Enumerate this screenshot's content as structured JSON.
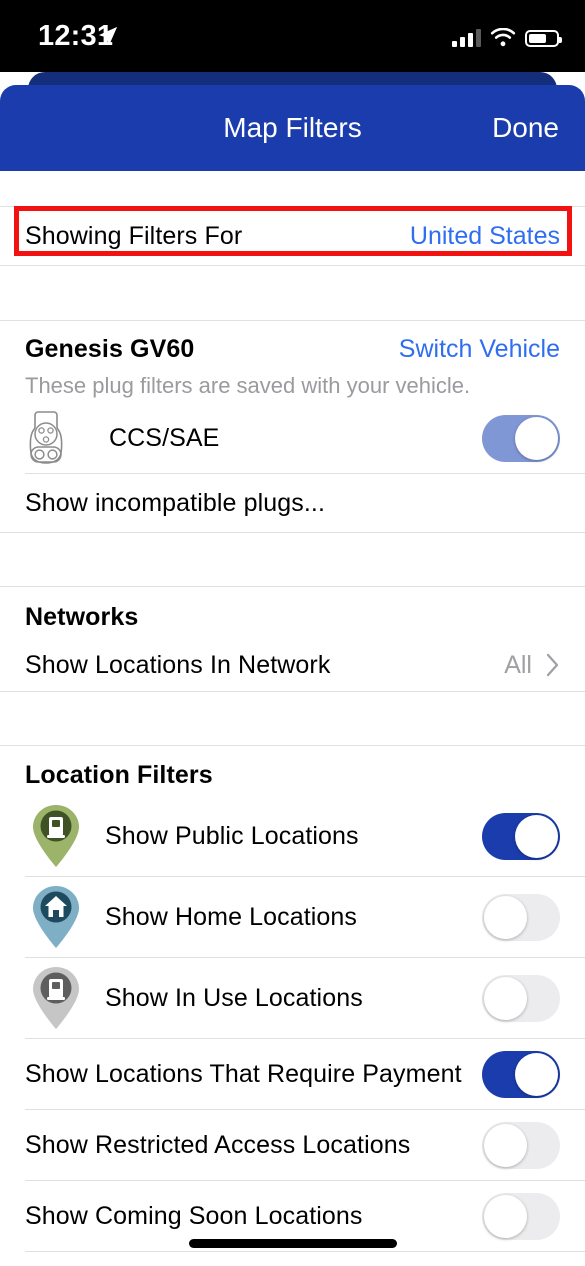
{
  "status_bar": {
    "time": "12:31",
    "location_icon": "location-arrow-icon",
    "cellular_icon": "cellular-bars-icon",
    "wifi_icon": "wifi-icon",
    "battery_icon": "battery-icon",
    "battery_level_percent": 65,
    "signal_bars_filled": 3,
    "signal_bars_total": 4
  },
  "navbar": {
    "title": "Map Filters",
    "done_label": "Done",
    "background_color": "#1a3cac",
    "back_card_color": "#152e7c"
  },
  "highlight": {
    "target": "Showing Filters For",
    "color": "#f21212"
  },
  "region_row": {
    "label": "Showing Filters For",
    "value": "United States",
    "value_color": "#2f6ef0"
  },
  "vehicle_section": {
    "title": "Genesis GV60",
    "action_label": "Switch Vehicle",
    "subtitle": "These plug filters are saved with your vehicle.",
    "plugs": [
      {
        "icon": "ccs-sae-plug-icon",
        "label": "CCS/SAE",
        "toggle_state": "on",
        "toggle_style": "dim",
        "toggle_color": "#8097d6"
      }
    ],
    "show_incompatible_label": "Show incompatible plugs..."
  },
  "networks_section": {
    "title": "Networks",
    "rows": [
      {
        "label": "Show Locations In Network",
        "value": "All",
        "accessory": "chevron-right-icon"
      }
    ]
  },
  "location_filters_section": {
    "title": "Location Filters",
    "rows": [
      {
        "icon": "map-pin-public-icon",
        "pin_color": "#9cb36a",
        "pin_inner_color": "#3e5226",
        "glyph": "charging-station-icon",
        "label": "Show Public Locations",
        "toggle_state": "on",
        "toggle_color": "#1a3cac"
      },
      {
        "icon": "map-pin-home-icon",
        "pin_color": "#7eafc4",
        "pin_inner_color": "#1d4a5e",
        "glyph": "house-icon",
        "label": "Show Home Locations",
        "toggle_state": "off",
        "toggle_color": "#ececee"
      },
      {
        "icon": "map-pin-in-use-icon",
        "pin_color": "#c6c6c6",
        "pin_inner_color": "#5e5e5e",
        "glyph": "charging-station-icon",
        "label": "Show In Use Locations",
        "toggle_state": "off",
        "toggle_color": "#ececee"
      },
      {
        "icon": null,
        "label": "Show Locations That Require Payment",
        "toggle_state": "on",
        "toggle_color": "#1a3cac"
      },
      {
        "icon": null,
        "label": "Show Restricted Access Locations",
        "toggle_state": "off",
        "toggle_color": "#ececee"
      },
      {
        "icon": null,
        "label": "Show Coming Soon Locations",
        "toggle_state": "off",
        "toggle_color": "#ececee"
      }
    ]
  },
  "home_indicator": "home-indicator-bar"
}
